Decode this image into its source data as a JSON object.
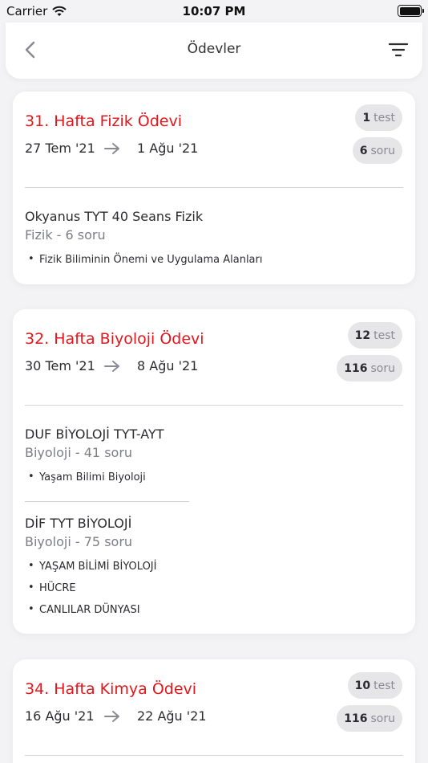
{
  "status_bar": {
    "carrier": "Carrier",
    "time": "10:07 PM"
  },
  "nav": {
    "title": "Ödevler"
  },
  "assignments": [
    {
      "title": "31. Hafta Fizik Ödevi",
      "start": "27 Tem '21",
      "end": "1 Ağu '21",
      "test_count": "1",
      "test_label": "test",
      "question_count": "6",
      "question_label": "soru",
      "sources": [
        {
          "name": "Okyanus TYT 40 Seans Fizik",
          "subtitle": "Fizik - 6 soru",
          "topics": [
            "Fizik Biliminin Önemi ve Uygulama Alanları"
          ]
        }
      ]
    },
    {
      "title": "32. Hafta Biyoloji Ödevi",
      "start": "30 Tem '21",
      "end": "8 Ağu '21",
      "test_count": "12",
      "test_label": "test",
      "question_count": "116",
      "question_label": "soru",
      "sources": [
        {
          "name": "DUF BİYOLOJİ TYT-AYT",
          "subtitle": "Biyoloji - 41 soru",
          "topics": [
            "Yaşam Bilimi Biyoloji"
          ]
        },
        {
          "name": "DİF TYT BİYOLOJİ",
          "subtitle": "Biyoloji - 75 soru",
          "topics": [
            "YAŞAM BİLİMİ BİYOLOJİ",
            "HÜCRE",
            "CANLILAR DÜNYASI"
          ]
        }
      ]
    },
    {
      "title": "34. Hafta Kimya Ödevi",
      "start": "16 Ağu '21",
      "end": "22 Ağu '21",
      "test_count": "10",
      "test_label": "test",
      "question_count": "116",
      "question_label": "soru",
      "sources": []
    }
  ],
  "colors": {
    "accent": "#e3161b",
    "background": "#f3f3f5",
    "badge": "#e6e6e9"
  }
}
